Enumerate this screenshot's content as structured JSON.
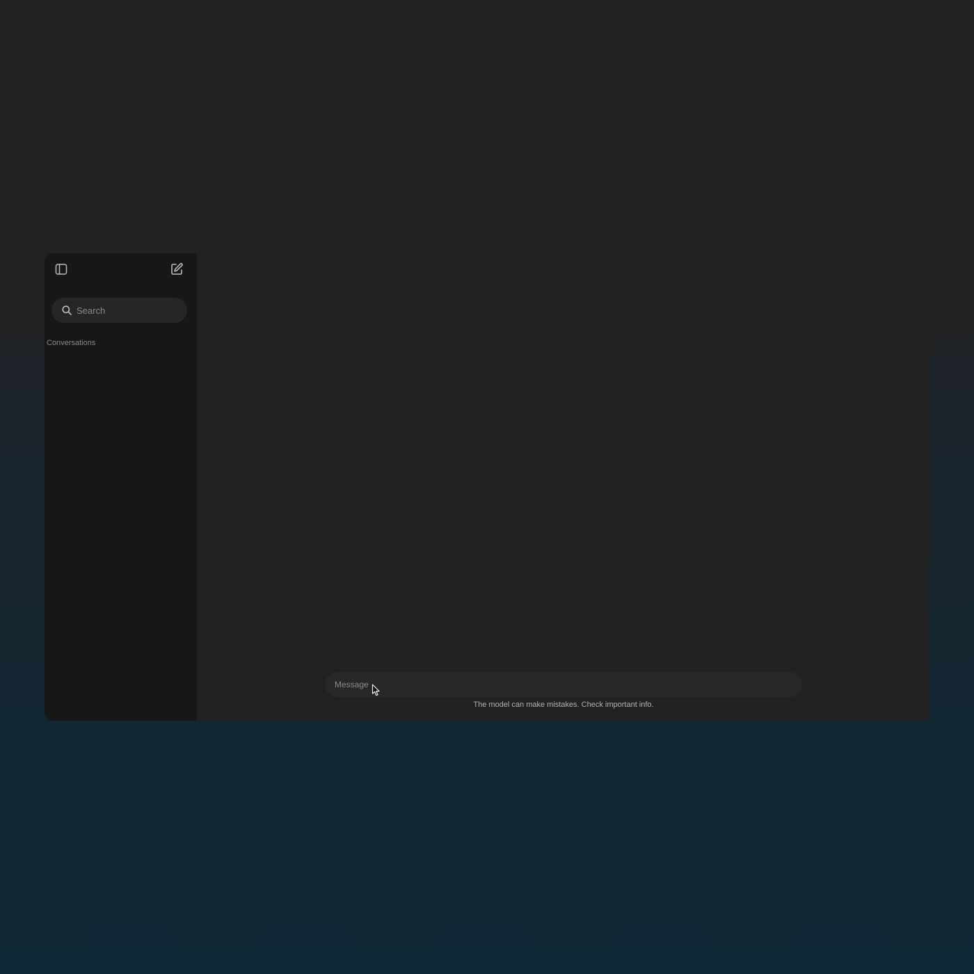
{
  "sidebar": {
    "toggle_icon": "sidebar-toggle-icon",
    "new_chat_icon": "compose-icon",
    "search": {
      "icon": "search-icon",
      "placeholder": "Search"
    },
    "section_label": "Conversations"
  },
  "composer": {
    "placeholder": "Message",
    "disclaimer": "The model can make mistakes. Check important info."
  },
  "colors": {
    "window_bg": "#212121",
    "sidebar_bg": "#171717",
    "input_bg": "#262626"
  }
}
